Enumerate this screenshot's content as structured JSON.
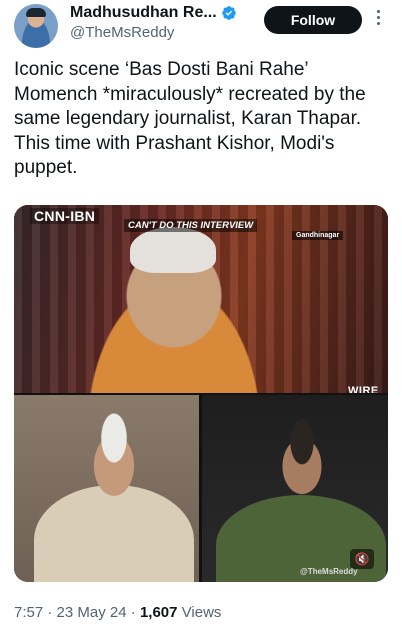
{
  "author": {
    "display_name": "Madhusudhan Re...",
    "handle": "@TheMsReddy",
    "verified": true,
    "verified_color": "#1d9bf0",
    "avatar_icon": "avatar"
  },
  "actions": {
    "follow_label": "Follow",
    "more_icon": "more-vertical-icon"
  },
  "tweet": {
    "text": "Iconic scene ‘Bas Dosti Bani Rahe’ Momench *miraculously* recreated by the same legendary journalist, Karan Thapar. This time with Prashant Kishor, Modi's puppet."
  },
  "media": {
    "channel_logo": "CNN-IBN",
    "show_title": "CAN'T DO THIS INTERVIEW",
    "location": "Gandhinagar",
    "wire_logo": "WIRE",
    "mute_icon": "speaker-muted-icon",
    "watermark": "@TheMsReddy"
  },
  "meta": {
    "time": "7:57",
    "date": "23 May 24",
    "views_count": "1,607",
    "views_label": "Views",
    "separator": "·"
  }
}
